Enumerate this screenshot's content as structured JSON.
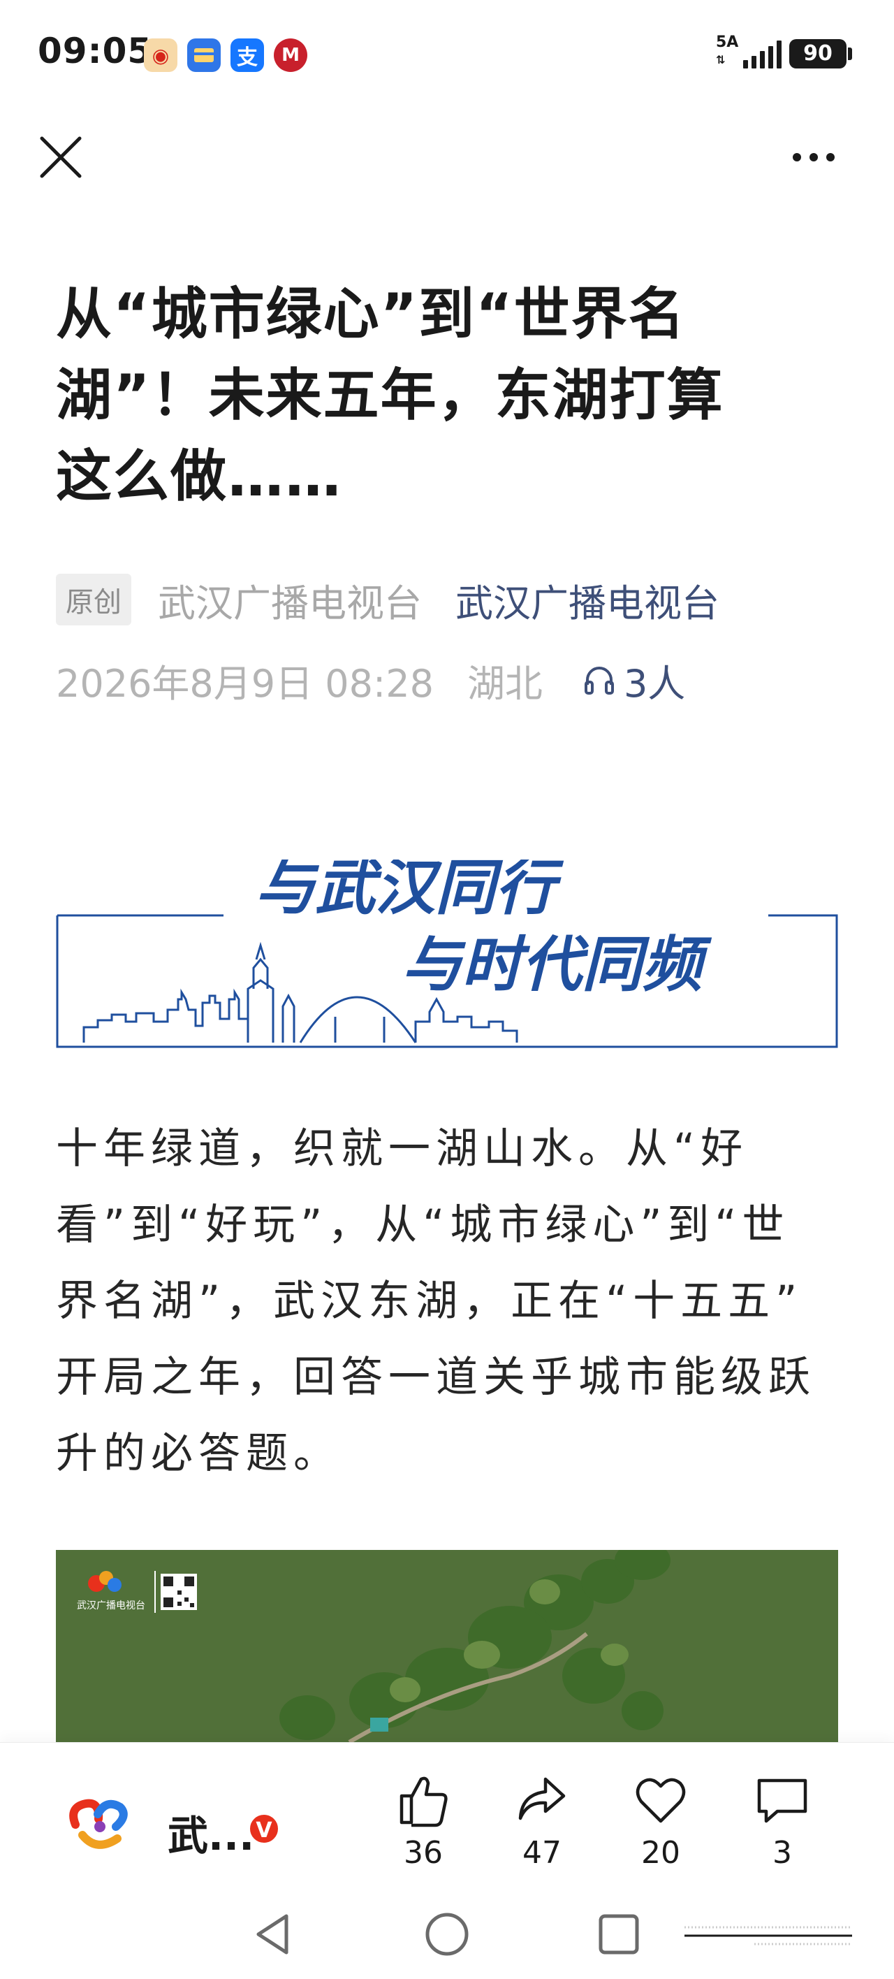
{
  "status_bar": {
    "time": "09:05",
    "network": "5A",
    "battery": "90",
    "app_icons": [
      "weibo-icon",
      "wallet-icon",
      "alipay-icon",
      "bank-icon"
    ]
  },
  "nav": {
    "close_icon": "close-icon",
    "more_icon": "more-icon"
  },
  "article": {
    "title_lines": [
      "从“城市绿心”到“世界名",
      "湖”！未来五年，东湖打算",
      "这么做……"
    ],
    "original_badge": "原创",
    "source": "武汉广播电视台",
    "account": "武汉广播电视台",
    "date": "2026年8月9日 08:28",
    "location": "湖北",
    "listeners": "3人",
    "banner_line1": "与武汉同行",
    "banner_line2": "与时代同频",
    "body_lines": [
      "十年绿道，织就一湖山水。从“好",
      "看”到“好玩”，从“城市绿心”到“世",
      "界名湖”，武汉东湖，正在“十五五”",
      "开局之年，回答一道关乎城市能级跃",
      "升的必答题。"
    ],
    "photo_caption": "武汉广播电视台"
  },
  "action_bar": {
    "account_name": "武...",
    "verified": "V",
    "likes": "36",
    "shares": "47",
    "favorites": "20",
    "comments": "3"
  },
  "colors": {
    "accent": "#3e4f78",
    "banner_blue": "#1f4f9e",
    "verified_red": "#e8301c"
  }
}
